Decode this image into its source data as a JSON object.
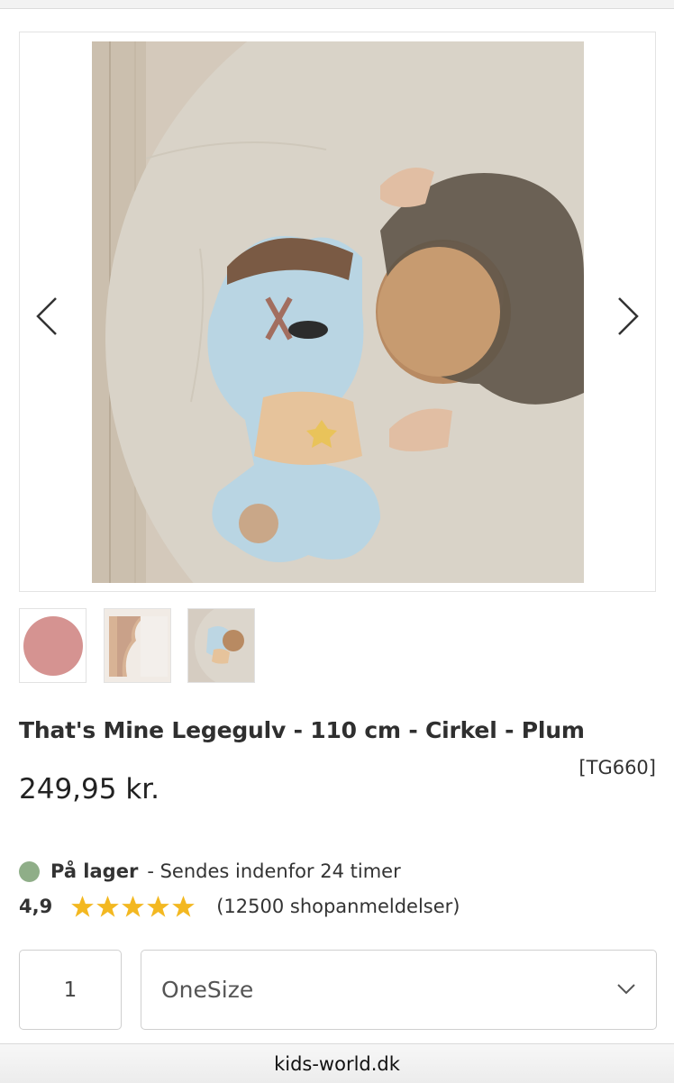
{
  "product": {
    "title": "That's Mine Legegulv - 110 cm - Cirkel - Plum",
    "sku": "[TG660]",
    "price": "249,95 kr."
  },
  "gallery": {
    "prev_icon": "chevron-left-icon",
    "next_icon": "chevron-right-icon",
    "thumbnails": [
      "pink-circle-mat",
      "cloud-shaped-mat",
      "child-playing-on-mat"
    ]
  },
  "availability": {
    "status": "På lager",
    "shipping": "- Sendes indenfor 24 timer",
    "status_color": "#8fae88"
  },
  "rating": {
    "value": "4,9",
    "stars": 5,
    "reviews": "(12500 shopanmeldelser)",
    "star_color": "#f3b821"
  },
  "purchase": {
    "quantity": "1",
    "size": "OneSize"
  },
  "browser": {
    "url": "kids-world.dk"
  }
}
